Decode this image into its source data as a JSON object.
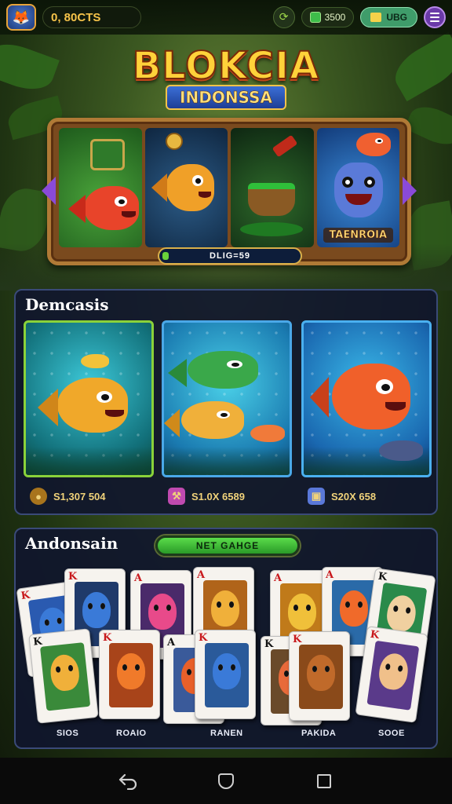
{
  "status_bar": {
    "coins": "0, 80CTS",
    "gems": "3500",
    "cash": "UBG"
  },
  "title": {
    "main": "BLOKCIA",
    "sub": "INDONSSA"
  },
  "featured": {
    "tiles": [
      {
        "name": "green-fish-tile",
        "label": ""
      },
      {
        "name": "orange-fish-tile",
        "label": ""
      },
      {
        "name": "cauldron-tile",
        "label": ""
      },
      {
        "name": "monster-tile",
        "label": "TAENROIA"
      }
    ],
    "progress_label": "DLIG=59"
  },
  "section_demo": {
    "title": "Demcasis",
    "games": [
      {
        "value": "S1,307 504",
        "icon": "coin-icon"
      },
      {
        "value": "S1.0X 6589",
        "icon": "axe-icon"
      },
      {
        "value": "S20X 658",
        "icon": "chest-icon"
      }
    ]
  },
  "section_cards": {
    "title": "Andonsain",
    "toggle_label": "NET GAHGE",
    "labels": [
      "SIOS",
      "ROAIO",
      "RANEN",
      "PAKIDA",
      "SOOE"
    ]
  },
  "colors": {
    "accent_gold": "#ffd23a",
    "panel_bg": "#10162c",
    "toggle_green": "#5adc4a"
  }
}
